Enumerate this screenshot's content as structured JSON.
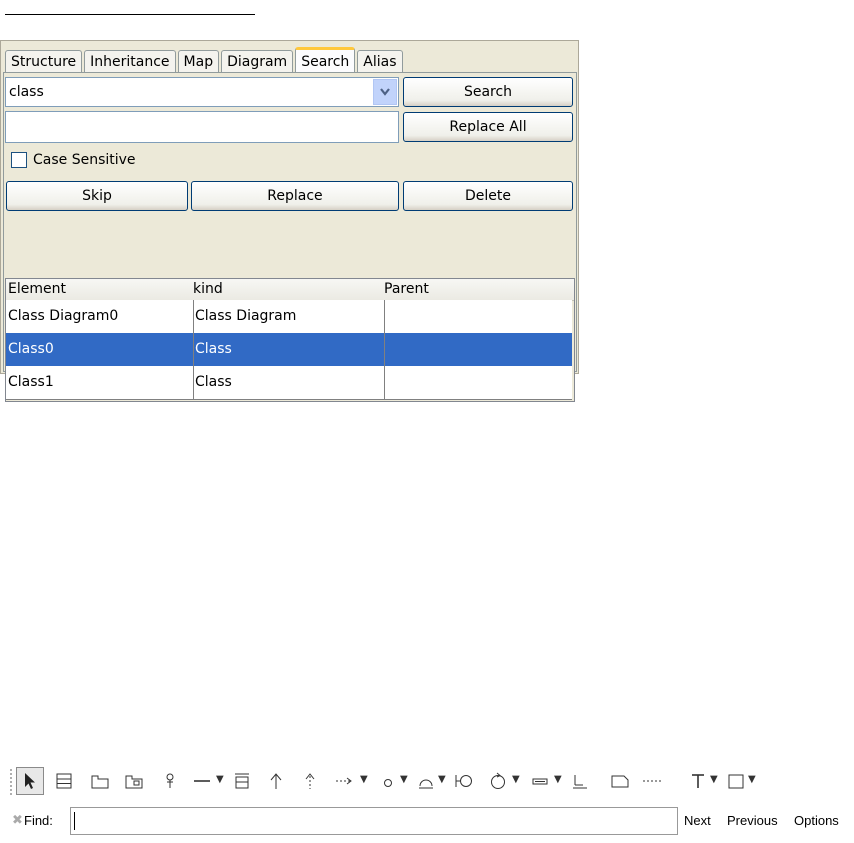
{
  "tabs": [
    "Structure",
    "Inheritance",
    "Map",
    "Diagram",
    "Search",
    "Alias"
  ],
  "active_tab": "Search",
  "search": {
    "query": "class",
    "replace_value": "",
    "search_button": "Search",
    "replace_all_button": "Replace All",
    "case_sensitive_label": "Case Sensitive",
    "case_sensitive_checked": false,
    "skip_button": "Skip",
    "replace_button": "Replace",
    "delete_button": "Delete"
  },
  "results": {
    "columns": [
      "Element",
      "kind",
      "Parent"
    ],
    "rows": [
      {
        "element": "Class Diagram0",
        "kind": "Class Diagram",
        "parent": ""
      },
      {
        "element": "Class0",
        "kind": "Class",
        "parent": ""
      },
      {
        "element": "Class1",
        "kind": "Class",
        "parent": ""
      }
    ],
    "selected_row_index": 1,
    "selection_color": "#316ac5"
  },
  "toolbar": {
    "tools": [
      "select-icon",
      "class-icon",
      "package-icon",
      "subsystem-icon",
      "actor-icon",
      "association-icon",
      "aggregation-icon",
      "generalization-icon",
      "realization-icon",
      "dependency-icon",
      "interface-icon",
      "component-icon",
      "node-icon",
      "control-icon",
      "note-icon",
      "anchor-icon",
      "constraint-icon",
      "dashline-icon",
      "text-icon",
      "rectangle-icon"
    ]
  },
  "findbar": {
    "label": "Find:",
    "value": "",
    "next": "Next",
    "previous": "Previous",
    "options": "Options"
  },
  "colors": {
    "panel_bg": "#ece9d8",
    "active_tab_accent": "#ffc83c",
    "button_border": "#003c74"
  }
}
